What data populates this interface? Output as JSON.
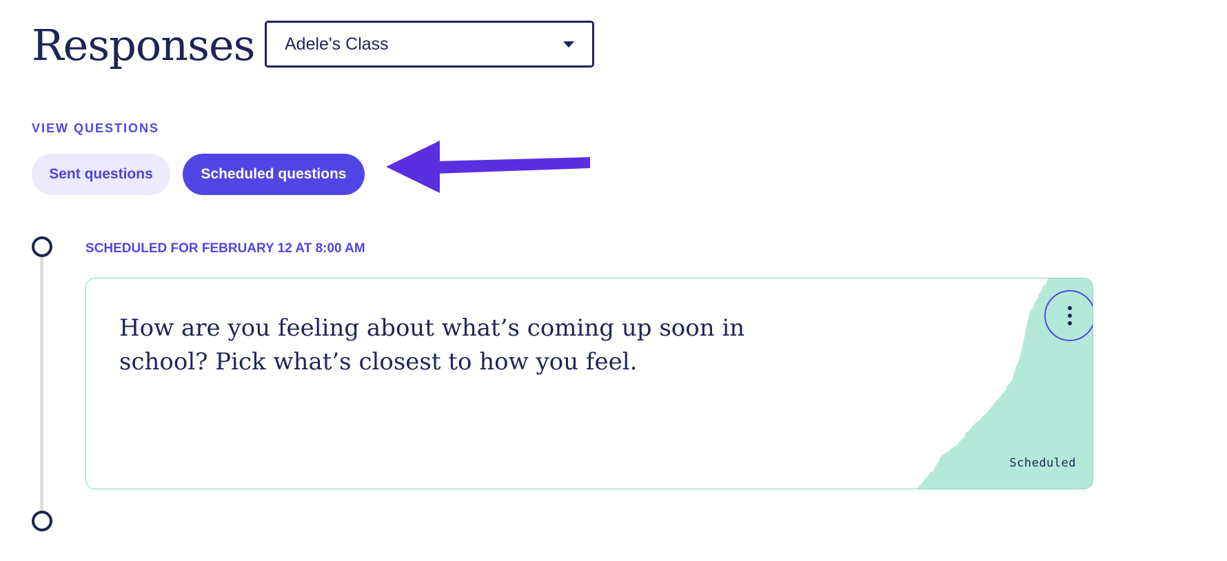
{
  "header": {
    "title": "Responses",
    "class_select": {
      "value": "Adele's Class",
      "icon": "chevron-down-icon"
    }
  },
  "view_questions": {
    "label": "VIEW QUESTIONS",
    "tabs": [
      {
        "label": "Sent questions",
        "active": false
      },
      {
        "label": "Scheduled questions",
        "active": true
      }
    ]
  },
  "timeline": {
    "items": [
      {
        "schedule_label": "SCHEDULED FOR FEBRUARY 12 AT 8:00 AM",
        "question": "How are you feeling about what’s coming up soon in school? Pick what’s closest to how you feel.",
        "status": "Scheduled",
        "menu_icon": "more-vertical-icon"
      }
    ]
  },
  "colors": {
    "navy": "#1f2456",
    "accent": "#5046e6",
    "accent_light": "#eceafc",
    "mint": "#b4e9d9",
    "mint_border": "#7fd9b8",
    "annotation_arrow": "#5a2fe0"
  }
}
